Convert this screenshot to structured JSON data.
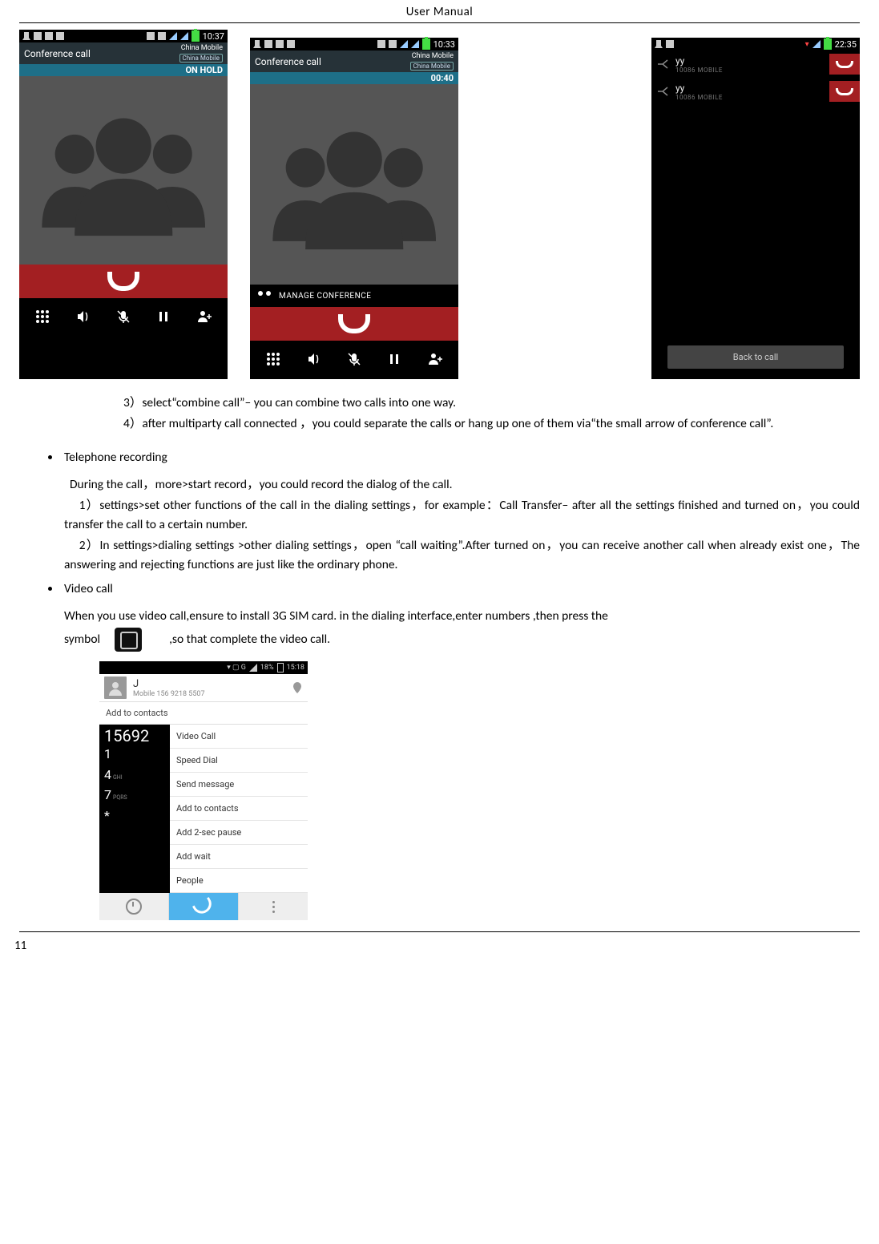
{
  "header": {
    "title": "User    Manual"
  },
  "shot1": {
    "clock": "10:37",
    "title": "Conference call",
    "carrier": "China Mobile",
    "carrier_tag": "China Mobile",
    "status": "ON HOLD",
    "buttons": [
      "dialpad",
      "speaker",
      "mute",
      "pause",
      "add"
    ]
  },
  "shot2": {
    "clock": "10:33",
    "title": "Conference call",
    "carrier": "China Mobile",
    "carrier_tag": "China Mobile",
    "duration": "00:40",
    "manage": "MANAGE CONFERENCE"
  },
  "shot3": {
    "clock": "22:35",
    "rows": [
      {
        "name": "yy",
        "sub": "10086  MOBILE"
      },
      {
        "name": "yy",
        "sub": "10086  MOBILE"
      }
    ],
    "back": "Back to call"
  },
  "steps": {
    "s3": "3）select“combine call”– you can combine two calls into one way.",
    "s4": "4）after multiparty call connected ，you could separate the calls or hang up one of them via“the small arrow of conference call”."
  },
  "tel_rec": {
    "heading": "Telephone recording",
    "p1": "During the call，more>start record，you could record the dialog of the call.",
    "p2": "1）settings>set other functions of the call in the dialing settings，for example：Call Transfer– after all the settings finished and turned on，you could transfer the call to a certain number.",
    "p3": "2）In settings>dialing settings >other dialing settings，open “call waiting”.After turned on，you can receive another call when already exist one，The answering and rejecting functions are just like the ordinary phone."
  },
  "video_call": {
    "heading": "Video call",
    "p1": "When you use video call,ensure to install 3G SIM card. in the dialing interface,enter numbers ,then press the",
    "p2a": "symbol",
    "p2b": ",so that complete the video call."
  },
  "video_shot": {
    "status_pct": "18%",
    "status_clock": "15:18",
    "contact_name": "J",
    "contact_sub": "Mobile 156 9218 5507",
    "add_contacts": "Add to contacts",
    "typed": "15692",
    "keys": [
      {
        "n": "1",
        "l": ""
      },
      {
        "n": "4",
        "l": "GHI"
      },
      {
        "n": "7",
        "l": "PQRS"
      },
      {
        "n": "*",
        "l": ""
      }
    ],
    "menu": [
      "Video Call",
      "Speed Dial",
      "Send message",
      "Add to contacts",
      "Add 2-sec pause",
      "Add wait",
      "People"
    ]
  },
  "page_number": "11"
}
